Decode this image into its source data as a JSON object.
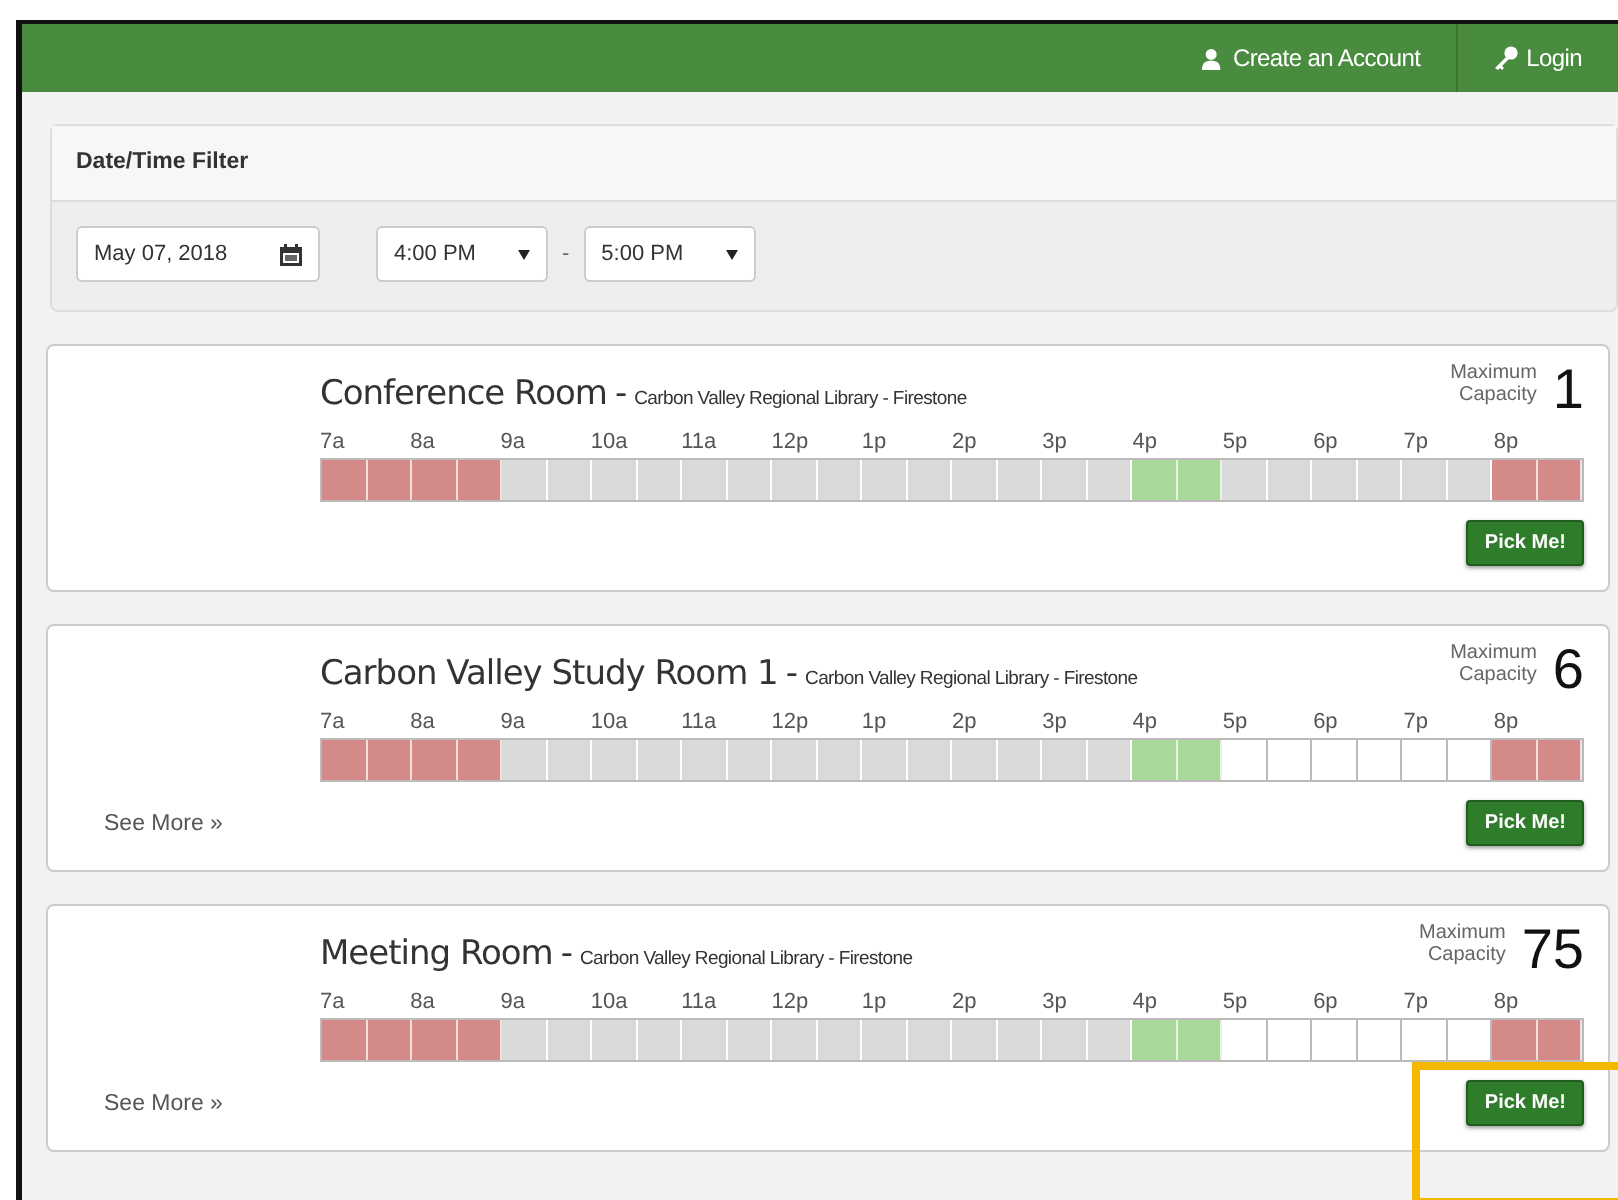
{
  "navbar": {
    "links": [
      {
        "label": "Create an Account"
      },
      {
        "label": "Login"
      }
    ]
  },
  "filter": {
    "title": "Date/Time Filter",
    "date": "May 07, 2018",
    "start_time": "4:00 PM",
    "separator": "-",
    "end_time": "5:00 PM"
  },
  "rooms": [
    {
      "name": "Conference Room",
      "separator": "-",
      "location": "Carbon Valley Regional Library - Firestone",
      "capacity_label": "Maximum Capacity",
      "capacity": "1",
      "button": "Pick Me!",
      "highlighted": false,
      "hours": [
        "7a",
        "8a",
        "9a",
        "10a",
        "11a",
        "12p",
        "1p",
        "2p",
        "3p",
        "4p",
        "5p",
        "6p",
        "7p",
        "8p"
      ],
      "slots": [
        {
          "kind": "booked"
        },
        {
          "kind": "booked"
        },
        {
          "kind": "booked"
        },
        {
          "kind": "booked"
        },
        {
          "kind": "unavailable"
        },
        {
          "kind": "unavailable"
        },
        {
          "kind": "unavailable"
        },
        {
          "kind": "unavailable"
        },
        {
          "kind": "unavailable"
        },
        {
          "kind": "unavailable"
        },
        {
          "kind": "unavailable"
        },
        {
          "kind": "unavailable"
        },
        {
          "kind": "unavailable"
        },
        {
          "kind": "unavailable"
        },
        {
          "kind": "unavailable"
        },
        {
          "kind": "unavailable"
        },
        {
          "kind": "unavailable"
        },
        {
          "kind": "unavailable"
        },
        {
          "kind": "selected"
        },
        {
          "kind": "selected"
        },
        {
          "kind": "unavailable"
        },
        {
          "kind": "unavailable"
        },
        {
          "kind": "unavailable"
        },
        {
          "kind": "unavailable"
        },
        {
          "kind": "unavailable"
        },
        {
          "kind": "unavailable"
        },
        {
          "kind": "booked"
        },
        {
          "kind": "booked"
        }
      ]
    },
    {
      "name": "Carbon Valley Study Room 1",
      "separator": "-",
      "location": "Carbon Valley Regional Library - Firestone",
      "capacity_label": "Maximum Capacity",
      "capacity": "6",
      "see_more": "See More »",
      "button": "Pick Me!",
      "highlighted": false,
      "hours": [
        "7a",
        "8a",
        "9a",
        "10a",
        "11a",
        "12p",
        "1p",
        "2p",
        "3p",
        "4p",
        "5p",
        "6p",
        "7p",
        "8p"
      ],
      "slots": [
        {
          "kind": "booked"
        },
        {
          "kind": "booked"
        },
        {
          "kind": "booked"
        },
        {
          "kind": "booked"
        },
        {
          "kind": "unavailable"
        },
        {
          "kind": "unavailable"
        },
        {
          "kind": "unavailable"
        },
        {
          "kind": "unavailable"
        },
        {
          "kind": "unavailable"
        },
        {
          "kind": "unavailable"
        },
        {
          "kind": "unavailable"
        },
        {
          "kind": "unavailable"
        },
        {
          "kind": "unavailable"
        },
        {
          "kind": "unavailable"
        },
        {
          "kind": "unavailable"
        },
        {
          "kind": "unavailable"
        },
        {
          "kind": "unavailable"
        },
        {
          "kind": "unavailable"
        },
        {
          "kind": "selected"
        },
        {
          "kind": "selected"
        },
        {
          "kind": "available"
        },
        {
          "kind": "available"
        },
        {
          "kind": "available"
        },
        {
          "kind": "available"
        },
        {
          "kind": "available"
        },
        {
          "kind": "available"
        },
        {
          "kind": "booked"
        },
        {
          "kind": "booked"
        }
      ]
    },
    {
      "name": "Meeting Room",
      "separator": "-",
      "location": "Carbon Valley Regional Library - Firestone",
      "capacity_label": "Maximum Capacity",
      "capacity": "75",
      "see_more": "See More »",
      "button": "Pick Me!",
      "highlighted": true,
      "hours": [
        "7a",
        "8a",
        "9a",
        "10a",
        "11a",
        "12p",
        "1p",
        "2p",
        "3p",
        "4p",
        "5p",
        "6p",
        "7p",
        "8p"
      ],
      "slots": [
        {
          "kind": "booked"
        },
        {
          "kind": "booked"
        },
        {
          "kind": "booked"
        },
        {
          "kind": "booked"
        },
        {
          "kind": "unavailable"
        },
        {
          "kind": "unavailable"
        },
        {
          "kind": "unavailable"
        },
        {
          "kind": "unavailable"
        },
        {
          "kind": "unavailable"
        },
        {
          "kind": "unavailable"
        },
        {
          "kind": "unavailable"
        },
        {
          "kind": "unavailable"
        },
        {
          "kind": "unavailable"
        },
        {
          "kind": "unavailable"
        },
        {
          "kind": "unavailable"
        },
        {
          "kind": "unavailable"
        },
        {
          "kind": "unavailable"
        },
        {
          "kind": "unavailable"
        },
        {
          "kind": "selected"
        },
        {
          "kind": "selected"
        },
        {
          "kind": "available"
        },
        {
          "kind": "available"
        },
        {
          "kind": "available"
        },
        {
          "kind": "available"
        },
        {
          "kind": "available"
        },
        {
          "kind": "available"
        },
        {
          "kind": "booked"
        },
        {
          "kind": "booked"
        }
      ]
    }
  ]
}
